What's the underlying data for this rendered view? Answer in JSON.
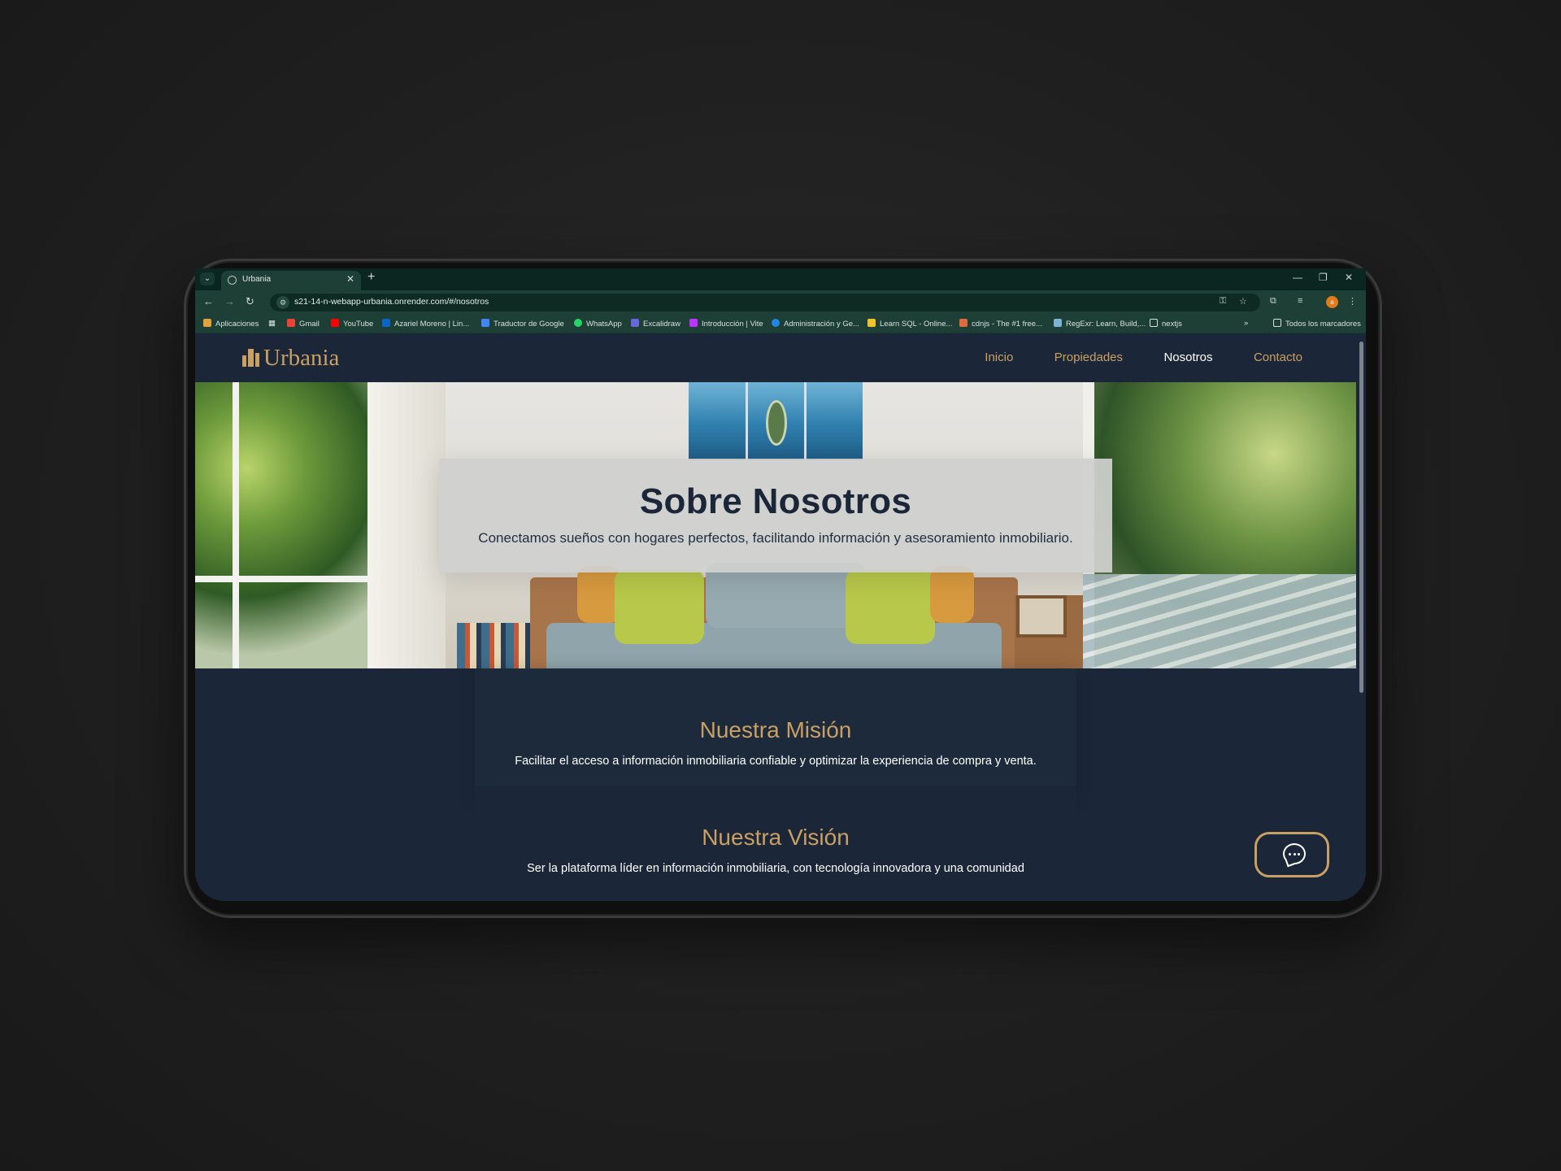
{
  "browser": {
    "tab_title": "Urbania",
    "url": "s21-14-n-webapp-urbania.onrender.com/#/nosotros",
    "bookmarks": [
      {
        "label": "Aplicaciones",
        "icon": "apps-grid-icon",
        "color": "#e0a23a"
      },
      {
        "label": "Gmail",
        "icon": "gmail-icon",
        "color": "#ea4335"
      },
      {
        "label": "YouTube",
        "icon": "youtube-icon",
        "color": "#ff0000"
      },
      {
        "label": "Azariel Moreno | Lin...",
        "icon": "linkedin-icon",
        "color": "#0a66c2"
      },
      {
        "label": "Traductor de Google",
        "icon": "google-translate-icon",
        "color": "#4285f4"
      },
      {
        "label": "WhatsApp",
        "icon": "whatsapp-icon",
        "color": "#25d366"
      },
      {
        "label": "Excalidraw",
        "icon": "excalidraw-icon",
        "color": "#6965db"
      },
      {
        "label": "Introducción | Vite",
        "icon": "vite-icon",
        "color": "#bd34fe"
      },
      {
        "label": "Administración y Ge...",
        "icon": "edge-icon",
        "color": "#1e88e5"
      },
      {
        "label": "Learn SQL - Online...",
        "icon": "sql-icon",
        "color": "#f2c12e"
      },
      {
        "label": "cdnjs - The #1 free...",
        "icon": "code-icon",
        "color": "#e06c3c"
      },
      {
        "label": "RegExr: Learn, Build,...",
        "icon": "regexr-icon",
        "color": "#7fb3d5"
      },
      {
        "label": "nextjs",
        "icon": "folder-icon",
        "color": "#d7e1dd"
      }
    ],
    "all_bookmarks": "Todos los marcadores",
    "profile_initial": "a"
  },
  "site": {
    "brand": "Urbania",
    "nav": [
      "Inicio",
      "Propiedades",
      "Nosotros",
      "Contacto"
    ],
    "active_nav": "Nosotros",
    "accent": "#c9a063",
    "background": "#1b2739"
  },
  "hero": {
    "title": "Sobre Nosotros",
    "subtitle": "Conectamos sueños con hogares perfectos, facilitando información y asesoramiento inmobiliario."
  },
  "mission": {
    "title": "Nuestra Misión",
    "text": "Facilitar el acceso a información inmobiliaria confiable y optimizar la experiencia de compra y venta."
  },
  "vision": {
    "title": "Nuestra Visión",
    "text": "Ser la plataforma líder en información inmobiliaria, con tecnología innovadora y una comunidad"
  },
  "chat": {
    "icon": "chat-bubble-icon"
  }
}
